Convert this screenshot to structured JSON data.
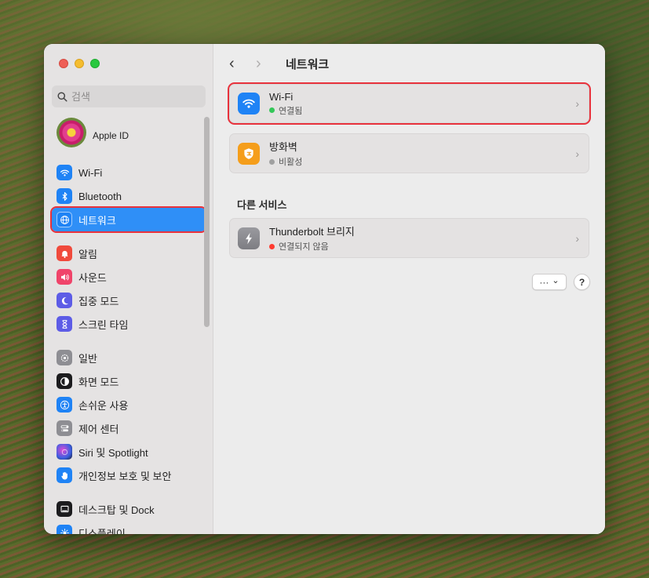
{
  "window": {
    "title": "네트워크"
  },
  "sidebar": {
    "search_placeholder": "검색",
    "apple_id": "Apple ID",
    "groups": [
      {
        "items": [
          {
            "label": "Wi-Fi",
            "icon": "wifi-icon",
            "color": "#1f83f5"
          },
          {
            "label": "Bluetooth",
            "icon": "bluetooth-icon",
            "color": "#1f83f5"
          },
          {
            "label": "네트워크",
            "icon": "globe-icon",
            "color": "#1f83f5",
            "active": true
          }
        ]
      },
      {
        "items": [
          {
            "label": "알림",
            "icon": "bell-icon",
            "color": "#f04a3c"
          },
          {
            "label": "사운드",
            "icon": "speaker-icon",
            "color": "#f0446a"
          },
          {
            "label": "집중 모드",
            "icon": "moon-icon",
            "color": "#5d5ce6"
          },
          {
            "label": "스크린 타임",
            "icon": "hourglass-icon",
            "color": "#5d5ce6"
          }
        ]
      },
      {
        "items": [
          {
            "label": "일반",
            "icon": "gear-icon",
            "color": "#8e8e93"
          },
          {
            "label": "화면 모드",
            "icon": "appearance-icon",
            "color": "#1c1c1e"
          },
          {
            "label": "손쉬운 사용",
            "icon": "accessibility-icon",
            "color": "#1f83f5"
          },
          {
            "label": "제어 센터",
            "icon": "control-center-icon",
            "color": "#8e8e93"
          },
          {
            "label": "Siri 및 Spotlight",
            "icon": "siri-icon",
            "color": "#7a3ad4"
          },
          {
            "label": "개인정보 보호 및 보안",
            "icon": "hand-icon",
            "color": "#1f83f5"
          }
        ]
      },
      {
        "items": [
          {
            "label": "데스크탑 및 Dock",
            "icon": "dock-icon",
            "color": "#1c1c1e"
          },
          {
            "label": "디스플레이",
            "icon": "display-icon",
            "color": "#1f83f5"
          }
        ]
      }
    ]
  },
  "toolbar": {
    "back": "‹",
    "forward": "›",
    "title": "네트워크"
  },
  "services": [
    {
      "name": "Wi-Fi",
      "status": "연결됨",
      "status_color": "#34c759",
      "icon": "wifi-icon",
      "icon_color": "#1f83f5"
    },
    {
      "name": "방화벽",
      "status": "비활성",
      "status_color": "#a0a0a0",
      "icon": "firewall-icon",
      "icon_color": "#f59e1b"
    }
  ],
  "other_services_title": "다른 서비스",
  "other_services": [
    {
      "name": "Thunderbolt 브리지",
      "status": "연결되지 않음",
      "status_color": "#ff3b30",
      "icon": "thunderbolt-icon",
      "icon_color": "#8e8e93"
    }
  ],
  "actions": {
    "more": "···",
    "more_chevron": "⌄",
    "help": "?"
  }
}
